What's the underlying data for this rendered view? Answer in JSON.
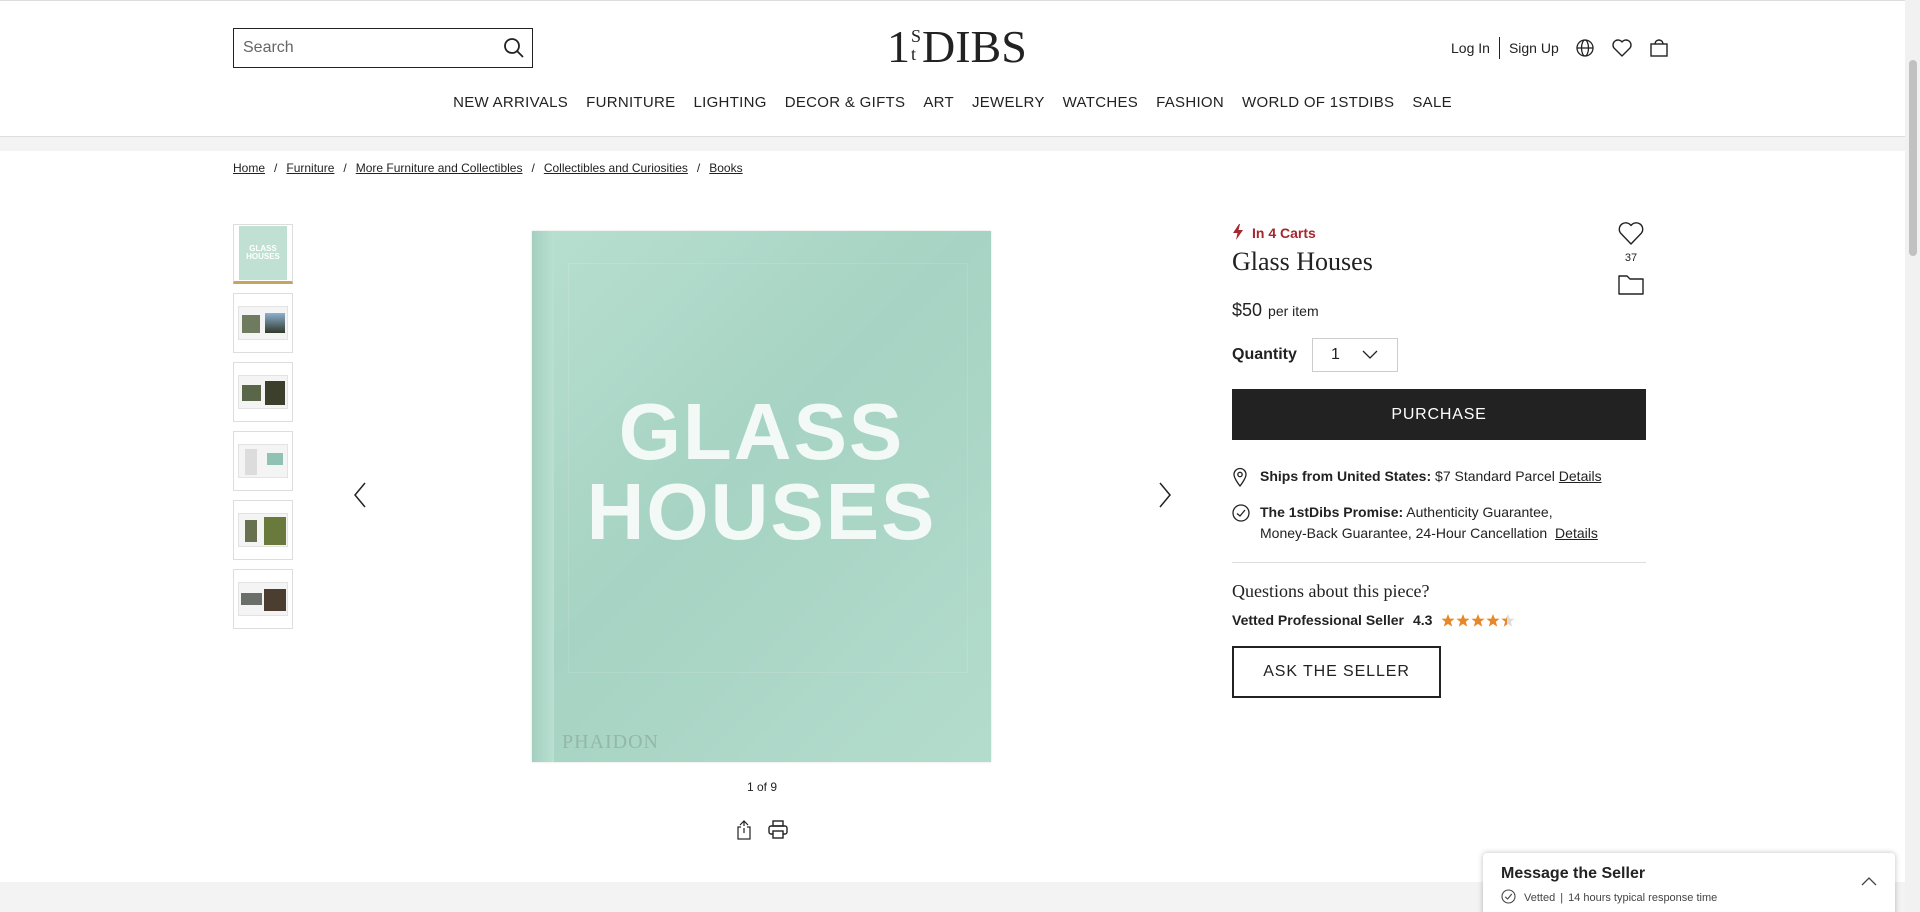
{
  "header": {
    "search_placeholder": "Search",
    "logo": {
      "one": "1",
      "s": "S",
      "t": "t",
      "dibs": "DIBS"
    },
    "login_label": "Log In",
    "signup_label": "Sign Up"
  },
  "nav": [
    "NEW ARRIVALS",
    "FURNITURE",
    "LIGHTING",
    "DECOR & GIFTS",
    "ART",
    "JEWELRY",
    "WATCHES",
    "FASHION",
    "WORLD OF 1STDIBS",
    "SALE"
  ],
  "breadcrumb": [
    "Home",
    "Furniture",
    "More Furniture and Collectibles",
    "Collectibles and Curiosities",
    "Books"
  ],
  "gallery": {
    "cover_line1": "GLASS",
    "cover_line2": "HOUSES",
    "publisher": "PHAIDON",
    "counter": "1 of 9",
    "thumb_cover_line1": "GLASS",
    "thumb_cover_line2": "HOUSES"
  },
  "product": {
    "in_carts": "In 4 Carts",
    "title": "Glass Houses",
    "favorites_count": "37",
    "price": "$50",
    "price_unit": "per item",
    "quantity_label": "Quantity",
    "quantity_value": "1",
    "purchase_label": "PURCHASE",
    "ships_label": "Ships from United States:",
    "ships_value": "$7 Standard Parcel",
    "ships_details": "Details",
    "promise_label": "The 1stDibs Promise:",
    "promise_line1": "Authenticity Guarantee,",
    "promise_line2": "Money-Back Guarantee, 24-Hour Cancellation",
    "promise_details": "Details",
    "questions": "Questions about this piece?",
    "seller_label": "Vetted Professional Seller",
    "seller_rating": "4.3",
    "rating_value": 4.3,
    "ask_label": "ASK THE SELLER"
  },
  "message_panel": {
    "title": "Message the Seller",
    "vetted": "Vetted",
    "separator": "|",
    "response": "14 hours typical response time"
  },
  "colors": {
    "accent_red": "#a6272e",
    "star": "#e8872a",
    "active_thumb": "#c2a661",
    "button_dark": "#222222"
  }
}
